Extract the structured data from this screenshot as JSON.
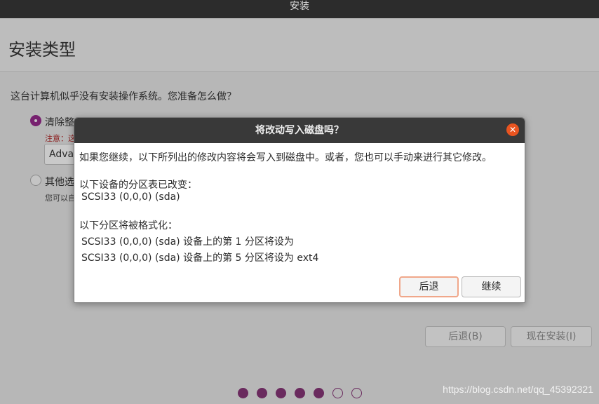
{
  "window": {
    "title": "安装"
  },
  "page": {
    "title": "安装类型",
    "question": "这台计算机似乎没有安装操作系统。您准备怎么做？",
    "option1": {
      "label": "清除整",
      "warning": "注意：这",
      "combo_value": "Adva"
    },
    "option2": {
      "label": "其他选",
      "sub": "您可以自"
    },
    "buttons": {
      "back": "后退(B)",
      "install": "现在安装(I)"
    }
  },
  "progress": {
    "total_steps": 7,
    "completed_steps": 5
  },
  "watermark": "https://blog.csdn.net/qq_45392321",
  "dialog": {
    "title": "将改动写入磁盘吗？",
    "intro": "如果您继续，以下所列出的修改内容将会写入到磁盘中。或者，您也可以手动来进行其它修改。",
    "partition_table_header": "以下设备的分区表已改变：",
    "partition_table_device": "SCSI33 (0,0,0) (sda)",
    "format_header": "以下分区将被格式化：",
    "format_items": [
      "SCSI33 (0,0,0) (sda) 设备上的第 1 分区将设为",
      "SCSI33 (0,0,0) (sda) 设备上的第 5 分区将设为 ext4"
    ],
    "back_button": "后退",
    "continue_button": "继续"
  },
  "colors": {
    "accent": "#77216f",
    "close": "#e95420",
    "titlebar": "#2c2c2c"
  }
}
